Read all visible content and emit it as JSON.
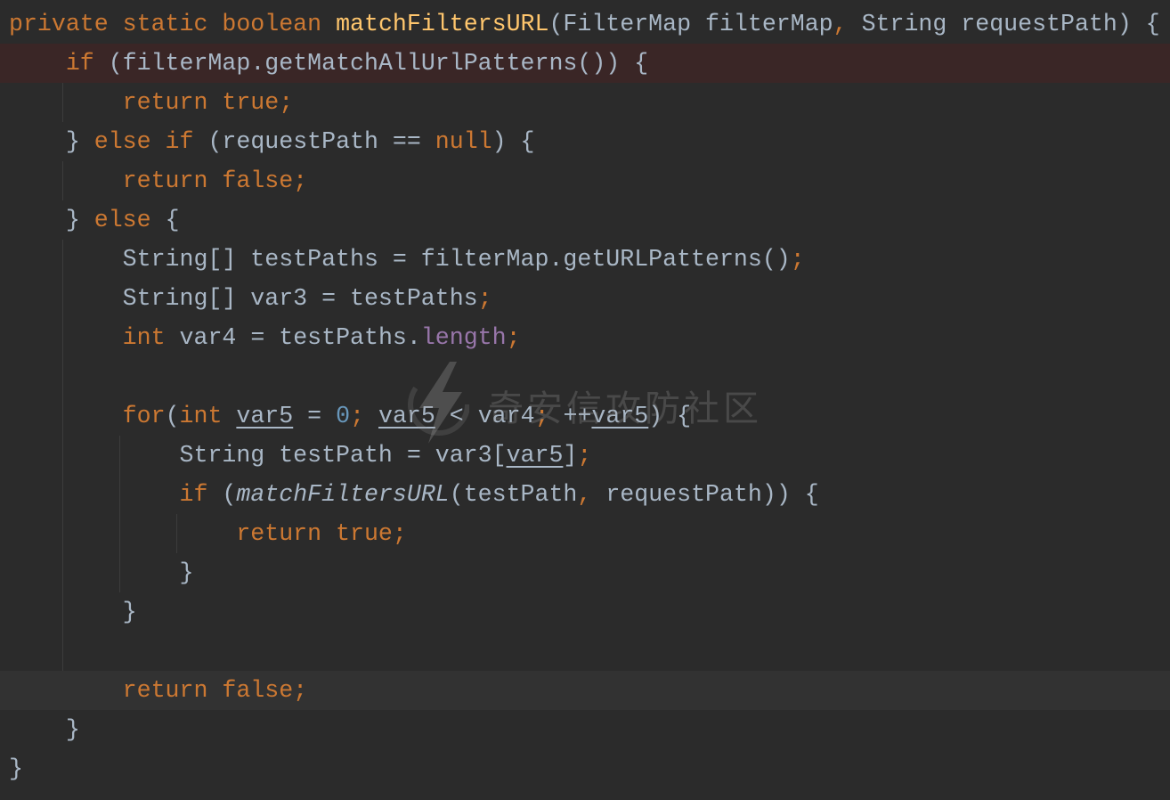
{
  "editor": {
    "theme": {
      "background": "#2b2b2b",
      "text": "#a9b7c6",
      "keyword": "#cc7832",
      "method_declaration": "#ffc66d",
      "number": "#6897bb",
      "field": "#9876aa",
      "indent_guide": "#3c3c3c"
    },
    "lines": [
      {
        "tokens": [
          {
            "t": "private static boolean ",
            "c": "#cc7832"
          },
          {
            "t": "matchFiltersURL",
            "c": "#ffc66d"
          },
          {
            "t": "(FilterMap filterMap"
          },
          {
            "t": ",",
            "c": "#cc7832"
          },
          {
            "t": " String requestPath) {"
          }
        ]
      },
      {
        "bg": "#3a2626",
        "tokens": [
          {
            "t": "    if",
            "c": "#cc7832"
          },
          {
            "t": " (filterMap.getMatchAllUrlPatterns()) {"
          }
        ]
      },
      {
        "tokens": [
          {
            "t": "        return true;",
            "c": "#cc7832"
          }
        ]
      },
      {
        "tokens": [
          {
            "t": "    } "
          },
          {
            "t": "else if",
            "c": "#cc7832"
          },
          {
            "t": " (requestPath == "
          },
          {
            "t": "null",
            "c": "#cc7832"
          },
          {
            "t": ") {"
          }
        ]
      },
      {
        "tokens": [
          {
            "t": "        return false;",
            "c": "#cc7832"
          }
        ]
      },
      {
        "tokens": [
          {
            "t": "    } "
          },
          {
            "t": "else",
            "c": "#cc7832"
          },
          {
            "t": " {"
          }
        ]
      },
      {
        "tokens": [
          {
            "t": "        String[] testPaths = filterMap.getURLPatterns()"
          },
          {
            "t": ";",
            "c": "#cc7832"
          }
        ]
      },
      {
        "tokens": [
          {
            "t": "        String[] var3 = testPaths"
          },
          {
            "t": ";",
            "c": "#cc7832"
          }
        ]
      },
      {
        "tokens": [
          {
            "t": "        int",
            "c": "#cc7832"
          },
          {
            "t": " var4 = testPaths."
          },
          {
            "t": "length",
            "c": "#9876aa"
          },
          {
            "t": ";",
            "c": "#cc7832"
          }
        ]
      },
      {
        "tokens": []
      },
      {
        "tokens": [
          {
            "t": "        for",
            "c": "#cc7832"
          },
          {
            "t": "("
          },
          {
            "t": "int ",
            "c": "#cc7832"
          },
          {
            "t": "var5",
            "underline": true
          },
          {
            "t": " = "
          },
          {
            "t": "0",
            "c": "#6897bb"
          },
          {
            "t": "; ",
            "c": "#cc7832"
          },
          {
            "t": "var5",
            "underline": true
          },
          {
            "t": " < var4"
          },
          {
            "t": ";",
            "c": "#cc7832"
          },
          {
            "t": " ++"
          },
          {
            "t": "var5",
            "underline": true
          },
          {
            "t": ") {"
          }
        ]
      },
      {
        "tokens": [
          {
            "t": "            String testPath = var3["
          },
          {
            "t": "var5",
            "underline": true
          },
          {
            "t": "]"
          },
          {
            "t": ";",
            "c": "#cc7832"
          }
        ]
      },
      {
        "tokens": [
          {
            "t": "            if",
            "c": "#cc7832"
          },
          {
            "t": " ("
          },
          {
            "t": "matchFiltersURL",
            "italic": true
          },
          {
            "t": "(testPath"
          },
          {
            "t": ",",
            "c": "#cc7832"
          },
          {
            "t": " requestPath)) {"
          }
        ]
      },
      {
        "tokens": [
          {
            "t": "                return true;",
            "c": "#cc7832"
          }
        ]
      },
      {
        "tokens": [
          {
            "t": "            }"
          }
        ]
      },
      {
        "tokens": [
          {
            "t": "        }"
          }
        ]
      },
      {
        "tokens": []
      },
      {
        "bg": "#323232",
        "tokens": [
          {
            "t": "        return false;",
            "c": "#cc7832"
          }
        ]
      },
      {
        "tokens": [
          {
            "t": "    }"
          }
        ]
      },
      {
        "tokens": [
          {
            "t": "}"
          }
        ]
      }
    ]
  },
  "watermark": {
    "logo_icon": "lightning-bolt-icon",
    "text": "奇安信攻防社区"
  }
}
